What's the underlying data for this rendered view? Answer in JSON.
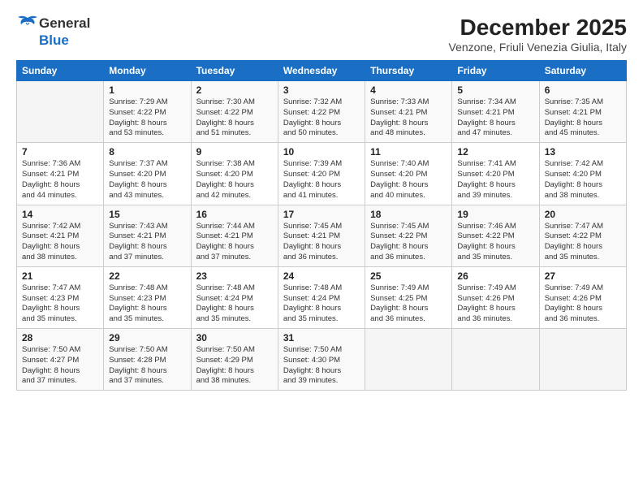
{
  "logo": {
    "line1": "General",
    "line2": "Blue"
  },
  "title": "December 2025",
  "subtitle": "Venzone, Friuli Venezia Giulia, Italy",
  "days_header": [
    "Sunday",
    "Monday",
    "Tuesday",
    "Wednesday",
    "Thursday",
    "Friday",
    "Saturday"
  ],
  "weeks": [
    [
      {
        "day": "",
        "content": ""
      },
      {
        "day": "1",
        "content": "Sunrise: 7:29 AM\nSunset: 4:22 PM\nDaylight: 8 hours\nand 53 minutes."
      },
      {
        "day": "2",
        "content": "Sunrise: 7:30 AM\nSunset: 4:22 PM\nDaylight: 8 hours\nand 51 minutes."
      },
      {
        "day": "3",
        "content": "Sunrise: 7:32 AM\nSunset: 4:22 PM\nDaylight: 8 hours\nand 50 minutes."
      },
      {
        "day": "4",
        "content": "Sunrise: 7:33 AM\nSunset: 4:21 PM\nDaylight: 8 hours\nand 48 minutes."
      },
      {
        "day": "5",
        "content": "Sunrise: 7:34 AM\nSunset: 4:21 PM\nDaylight: 8 hours\nand 47 minutes."
      },
      {
        "day": "6",
        "content": "Sunrise: 7:35 AM\nSunset: 4:21 PM\nDaylight: 8 hours\nand 45 minutes."
      }
    ],
    [
      {
        "day": "7",
        "content": "Sunrise: 7:36 AM\nSunset: 4:21 PM\nDaylight: 8 hours\nand 44 minutes."
      },
      {
        "day": "8",
        "content": "Sunrise: 7:37 AM\nSunset: 4:20 PM\nDaylight: 8 hours\nand 43 minutes."
      },
      {
        "day": "9",
        "content": "Sunrise: 7:38 AM\nSunset: 4:20 PM\nDaylight: 8 hours\nand 42 minutes."
      },
      {
        "day": "10",
        "content": "Sunrise: 7:39 AM\nSunset: 4:20 PM\nDaylight: 8 hours\nand 41 minutes."
      },
      {
        "day": "11",
        "content": "Sunrise: 7:40 AM\nSunset: 4:20 PM\nDaylight: 8 hours\nand 40 minutes."
      },
      {
        "day": "12",
        "content": "Sunrise: 7:41 AM\nSunset: 4:20 PM\nDaylight: 8 hours\nand 39 minutes."
      },
      {
        "day": "13",
        "content": "Sunrise: 7:42 AM\nSunset: 4:20 PM\nDaylight: 8 hours\nand 38 minutes."
      }
    ],
    [
      {
        "day": "14",
        "content": "Sunrise: 7:42 AM\nSunset: 4:21 PM\nDaylight: 8 hours\nand 38 minutes."
      },
      {
        "day": "15",
        "content": "Sunrise: 7:43 AM\nSunset: 4:21 PM\nDaylight: 8 hours\nand 37 minutes."
      },
      {
        "day": "16",
        "content": "Sunrise: 7:44 AM\nSunset: 4:21 PM\nDaylight: 8 hours\nand 37 minutes."
      },
      {
        "day": "17",
        "content": "Sunrise: 7:45 AM\nSunset: 4:21 PM\nDaylight: 8 hours\nand 36 minutes."
      },
      {
        "day": "18",
        "content": "Sunrise: 7:45 AM\nSunset: 4:22 PM\nDaylight: 8 hours\nand 36 minutes."
      },
      {
        "day": "19",
        "content": "Sunrise: 7:46 AM\nSunset: 4:22 PM\nDaylight: 8 hours\nand 35 minutes."
      },
      {
        "day": "20",
        "content": "Sunrise: 7:47 AM\nSunset: 4:22 PM\nDaylight: 8 hours\nand 35 minutes."
      }
    ],
    [
      {
        "day": "21",
        "content": "Sunrise: 7:47 AM\nSunset: 4:23 PM\nDaylight: 8 hours\nand 35 minutes."
      },
      {
        "day": "22",
        "content": "Sunrise: 7:48 AM\nSunset: 4:23 PM\nDaylight: 8 hours\nand 35 minutes."
      },
      {
        "day": "23",
        "content": "Sunrise: 7:48 AM\nSunset: 4:24 PM\nDaylight: 8 hours\nand 35 minutes."
      },
      {
        "day": "24",
        "content": "Sunrise: 7:48 AM\nSunset: 4:24 PM\nDaylight: 8 hours\nand 35 minutes."
      },
      {
        "day": "25",
        "content": "Sunrise: 7:49 AM\nSunset: 4:25 PM\nDaylight: 8 hours\nand 36 minutes."
      },
      {
        "day": "26",
        "content": "Sunrise: 7:49 AM\nSunset: 4:26 PM\nDaylight: 8 hours\nand 36 minutes."
      },
      {
        "day": "27",
        "content": "Sunrise: 7:49 AM\nSunset: 4:26 PM\nDaylight: 8 hours\nand 36 minutes."
      }
    ],
    [
      {
        "day": "28",
        "content": "Sunrise: 7:50 AM\nSunset: 4:27 PM\nDaylight: 8 hours\nand 37 minutes."
      },
      {
        "day": "29",
        "content": "Sunrise: 7:50 AM\nSunset: 4:28 PM\nDaylight: 8 hours\nand 37 minutes."
      },
      {
        "day": "30",
        "content": "Sunrise: 7:50 AM\nSunset: 4:29 PM\nDaylight: 8 hours\nand 38 minutes."
      },
      {
        "day": "31",
        "content": "Sunrise: 7:50 AM\nSunset: 4:30 PM\nDaylight: 8 hours\nand 39 minutes."
      },
      {
        "day": "",
        "content": ""
      },
      {
        "day": "",
        "content": ""
      },
      {
        "day": "",
        "content": ""
      }
    ]
  ]
}
